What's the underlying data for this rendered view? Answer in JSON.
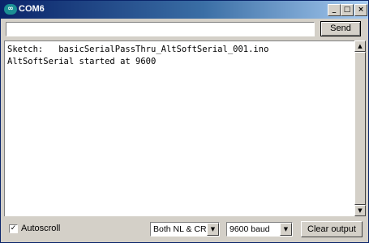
{
  "window": {
    "title": "COM6",
    "app_icon": "arduino-infinity-icon",
    "controls": {
      "minimize": "_",
      "maximize": "□",
      "close": "×"
    }
  },
  "send_bar": {
    "input_value": "",
    "send_label": "Send"
  },
  "output": {
    "lines": [
      "Sketch:   basicSerialPassThru_AltSoftSerial_001.ino",
      "AltSoftSerial started at 9600"
    ]
  },
  "scrollbar": {
    "up_glyph": "▲",
    "down_glyph": "▼"
  },
  "bottom": {
    "autoscroll_label": "Autoscroll",
    "autoscroll_checked": true,
    "check_glyph": "✓",
    "line_ending": "Both NL & CR",
    "baud_rate": "9600 baud",
    "dropdown_glyph": "▼",
    "clear_label": "Clear output"
  },
  "colors": {
    "titlebar_start": "#0a246a",
    "titlebar_end": "#a6caf0",
    "chrome": "#d4d0c8",
    "arduino_teal": "#1b8f94"
  }
}
